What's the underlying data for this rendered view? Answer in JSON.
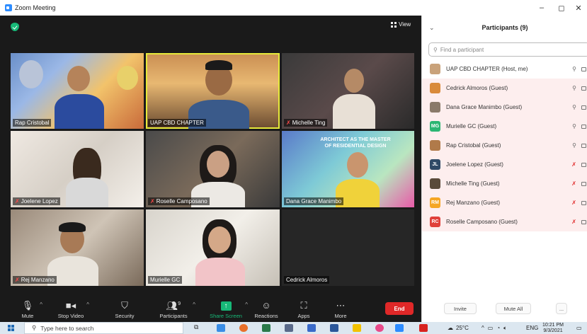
{
  "window": {
    "title": "Zoom Meeting",
    "minimize": "–",
    "restore": "◻",
    "close": "✕"
  },
  "meeting": {
    "view_label": "View",
    "tiles": [
      {
        "name": "Rap Cristobal",
        "muted": false
      },
      {
        "name": "UAP CBD CHAPTER",
        "muted": false
      },
      {
        "name": "Michelle Ting",
        "muted": true
      },
      {
        "name": "Joelene Lopez",
        "muted": true
      },
      {
        "name": "Roselle Camposano",
        "muted": true
      },
      {
        "name": "Dana Grace Manimbo",
        "muted": false
      },
      {
        "name": "Rej Manzano",
        "muted": true
      },
      {
        "name": "Murielle GC",
        "muted": false
      },
      {
        "name": "Cedrick Almoros",
        "muted": false
      }
    ],
    "background_text": {
      "line1": "ARCHITECT AS THE MASTER",
      "line2": "OF RESIDENTIAL DESIGN"
    }
  },
  "toolbar": {
    "mute": "Mute",
    "stop_video": "Stop Video",
    "security": "Security",
    "participants": "Participants",
    "participants_count": "9",
    "share_screen": "Share Screen",
    "reactions": "Reactions",
    "apps": "Apps",
    "more": "More",
    "end": "End"
  },
  "panel": {
    "title": "Participants (9)",
    "search_placeholder": "Find a participant",
    "participants": [
      {
        "name": "UAP CBD CHAPTER (Host, me)",
        "initials": "",
        "color": "#c9a27a",
        "muted": false,
        "highlight": false
      },
      {
        "name": "Cedrick Almoros (Guest)",
        "initials": "",
        "color": "#d98a3a",
        "muted": false,
        "highlight": true
      },
      {
        "name": "Dana Grace Manimbo (Guest)",
        "initials": "",
        "color": "#8a7a6a",
        "muted": false,
        "highlight": true
      },
      {
        "name": "Murielle GC (Guest)",
        "initials": "MG",
        "color": "#2bb673",
        "muted": false,
        "highlight": true
      },
      {
        "name": "Rap Cristobal (Guest)",
        "initials": "",
        "color": "#b07a4a",
        "muted": false,
        "highlight": true
      },
      {
        "name": "Joelene Lopez (Guest)",
        "initials": "JL",
        "color": "#2f4a66",
        "muted": true,
        "highlight": true
      },
      {
        "name": "Michelle Ting (Guest)",
        "initials": "",
        "color": "#5a4a3a",
        "muted": true,
        "highlight": true
      },
      {
        "name": "Rej Manzano (Guest)",
        "initials": "RM",
        "color": "#f5a623",
        "muted": true,
        "highlight": true
      },
      {
        "name": "Roselle Camposano (Guest)",
        "initials": "RC",
        "color": "#e0403a",
        "muted": true,
        "highlight": true
      }
    ],
    "invite": "Invite",
    "mute_all": "Mute All",
    "more": "..."
  },
  "taskbar": {
    "search_placeholder": "Type here to search",
    "temperature": "25°C",
    "language": "ENG",
    "time": "10:21 PM",
    "date": "9/3/2021"
  }
}
